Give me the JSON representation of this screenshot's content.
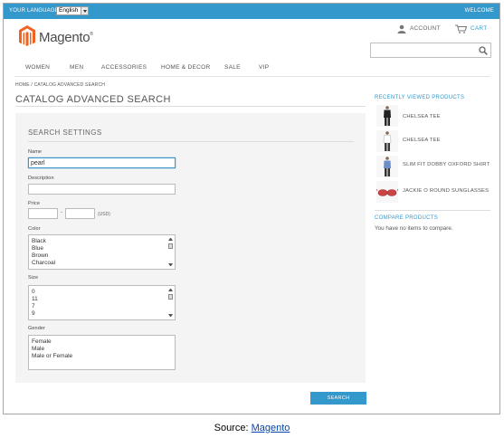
{
  "topbar": {
    "language_label": "YOUR LANGUAGE",
    "language_value": "English",
    "welcome": "WELCOME"
  },
  "header": {
    "logo_text": "Magento",
    "account_label": "ACCOUNT",
    "cart_label": "CART",
    "search_value": ""
  },
  "nav": {
    "items": [
      "WOMEN",
      "MEN",
      "ACCESSORIES",
      "HOME & DECOR",
      "SALE",
      "VIP"
    ]
  },
  "breadcrumb": "HOME / CATALOG ADVANCED SEARCH",
  "page_title": "CATALOG ADVANCED SEARCH",
  "form": {
    "section_title": "SEARCH SETTINGS",
    "name_label": "Name",
    "name_value": "pearl",
    "description_label": "Description",
    "description_value": "",
    "price_label": "Price",
    "price_from": "",
    "price_to": "",
    "price_dash": "-",
    "price_unit": "(USD)",
    "color_label": "Color",
    "color_options": [
      "Black",
      "Blue",
      "Brown",
      "Charcoal"
    ],
    "size_label": "Size",
    "size_options": [
      "0",
      "11",
      "7",
      "9"
    ],
    "gender_label": "Gender",
    "gender_options": [
      "Female",
      "Male",
      "Male or Female"
    ],
    "search_button": "SEARCH"
  },
  "sidebar": {
    "recent_title": "RECENTLY VIEWED PRODUCTS",
    "products": [
      {
        "name": "CHELSEA TEE",
        "icon": "black-tee-icon"
      },
      {
        "name": "CHELSEA TEE",
        "icon": "white-tee-icon"
      },
      {
        "name": "SLIM FIT DOBBY OXFORD SHIRT",
        "icon": "blue-shirt-icon"
      },
      {
        "name": "JACKIE O ROUND SUNGLASSES",
        "icon": "sunglasses-icon"
      }
    ],
    "compare_title": "COMPARE PRODUCTS",
    "compare_text": "You have no items to compare."
  },
  "caption": {
    "prefix": "Source: ",
    "link_text": "Magento"
  },
  "colors": {
    "accent": "#3399cc",
    "logo_orange": "#f26322"
  }
}
